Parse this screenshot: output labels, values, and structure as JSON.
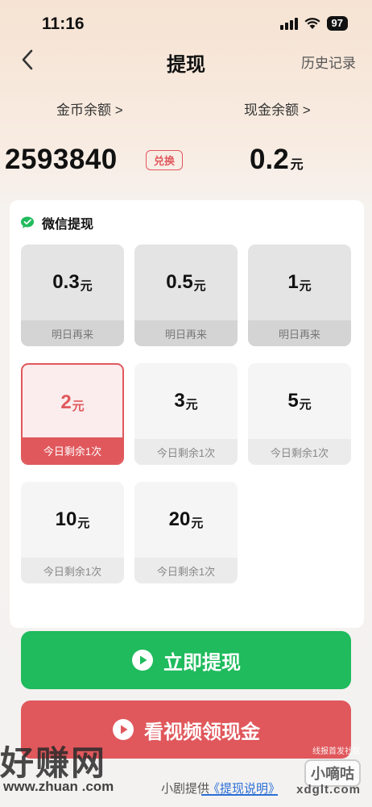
{
  "status_bar": {
    "time": "11:16",
    "battery": "97"
  },
  "nav": {
    "title": "提现",
    "history": "历史记录"
  },
  "balances": {
    "coin_label": "金币余额 >",
    "coin_amount": "2593840",
    "exchange": "兑换",
    "cash_label": "现金余额 >",
    "cash_amount": "0.2",
    "cash_unit": "元"
  },
  "card": {
    "title": "微信提现",
    "unit": "元",
    "options": [
      {
        "amount": "0.3",
        "note": "明日再来",
        "state": "disabled"
      },
      {
        "amount": "0.5",
        "note": "明日再来",
        "state": "disabled"
      },
      {
        "amount": "1",
        "note": "明日再来",
        "state": "disabled"
      },
      {
        "amount": "2",
        "note": "今日剩余1次",
        "state": "selected"
      },
      {
        "amount": "3",
        "note": "今日剩余1次",
        "state": "normal"
      },
      {
        "amount": "5",
        "note": "今日剩余1次",
        "state": "normal"
      },
      {
        "amount": "10",
        "note": "今日剩余1次",
        "state": "normal"
      },
      {
        "amount": "20",
        "note": "今日剩余1次",
        "state": "normal"
      }
    ]
  },
  "buttons": {
    "withdraw": "立即提现",
    "video": "看视频领现金"
  },
  "footer": {
    "provider": "小剧提供",
    "link": "《提现说明》"
  },
  "watermarks": {
    "left_main": "好赚网",
    "left_url": "www.zhuan  .com",
    "right_small": "线报首发社区",
    "right_box": "小嘀咕",
    "right_domain": "xdglt.com"
  },
  "colors": {
    "accent_red": "#e0585c",
    "accent_green": "#1fbb5d",
    "link_blue": "#2a6fd6"
  }
}
